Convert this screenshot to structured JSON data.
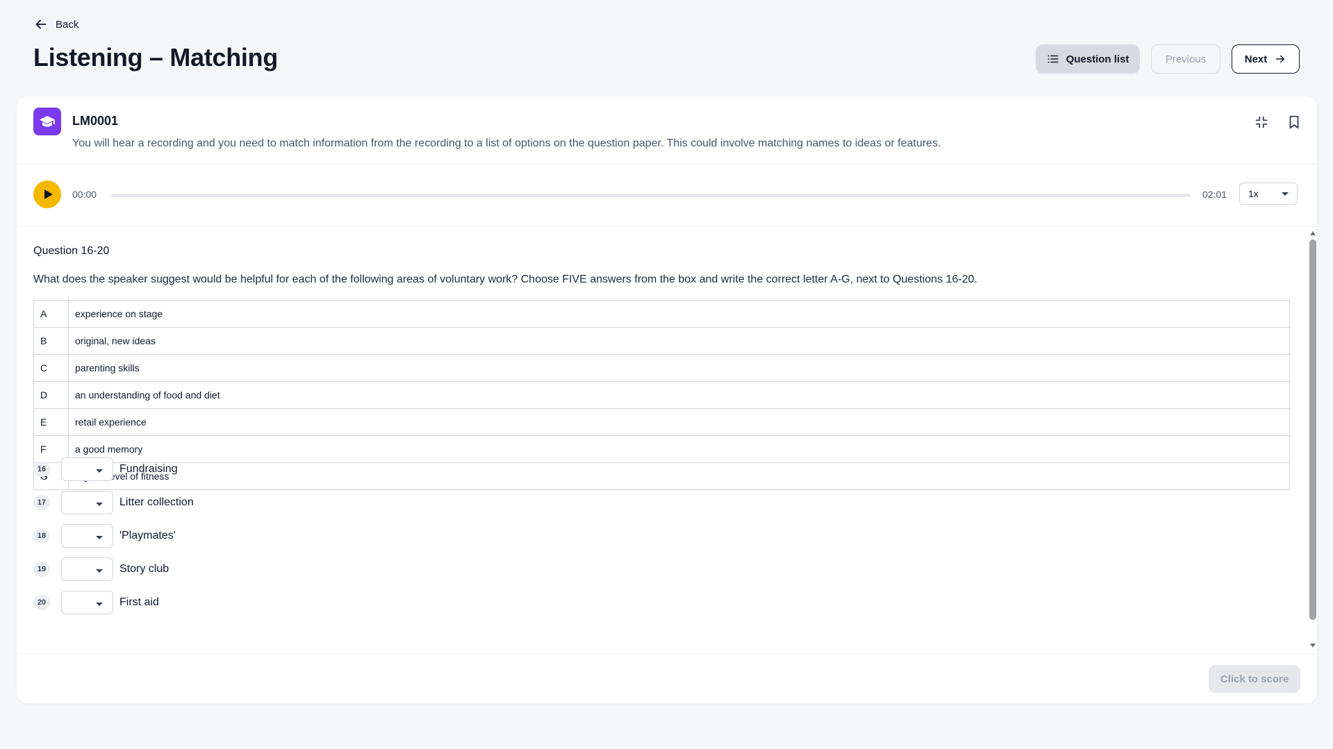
{
  "header": {
    "back_label": "Back",
    "title": "Listening – Matching",
    "question_list_label": "Question list",
    "previous_label": "Previous",
    "next_label": "Next"
  },
  "question": {
    "code": "LM0001",
    "description": "You will hear a recording and you need to match information from the recording to a list of options on the question paper. This could involve matching names to ideas or features.",
    "icon": "graduation-cap-icon",
    "accent_color": "#7c3aed"
  },
  "player": {
    "current_time": "00:00",
    "duration": "02:01",
    "progress": 0,
    "speed": "1x",
    "play_color": "#f5b800"
  },
  "section": {
    "range": "Question 16-20",
    "instruction": "What does the speaker suggest would be helpful for each of the following areas of voluntary work? Choose FIVE answers from the box and write the correct letter A-G, next to Questions 16-20."
  },
  "options": [
    {
      "letter": "A",
      "text": "experience on stage"
    },
    {
      "letter": "B",
      "text": "original, new ideas"
    },
    {
      "letter": "C",
      "text": "parenting skills"
    },
    {
      "letter": "D",
      "text": "an understanding of food and diet"
    },
    {
      "letter": "E",
      "text": "retail experience"
    },
    {
      "letter": "F",
      "text": "a good memory"
    },
    {
      "letter": "G",
      "text": "a good level of fitness"
    }
  ],
  "answers": [
    {
      "number": "16",
      "label": "Fundraising",
      "selected": ""
    },
    {
      "number": "17",
      "label": "Litter collection",
      "selected": ""
    },
    {
      "number": "18",
      "label": "'Playmates'",
      "selected": ""
    },
    {
      "number": "19",
      "label": "Story club",
      "selected": ""
    },
    {
      "number": "20",
      "label": "First aid",
      "selected": ""
    }
  ],
  "footer": {
    "score_label": "Click to score"
  }
}
